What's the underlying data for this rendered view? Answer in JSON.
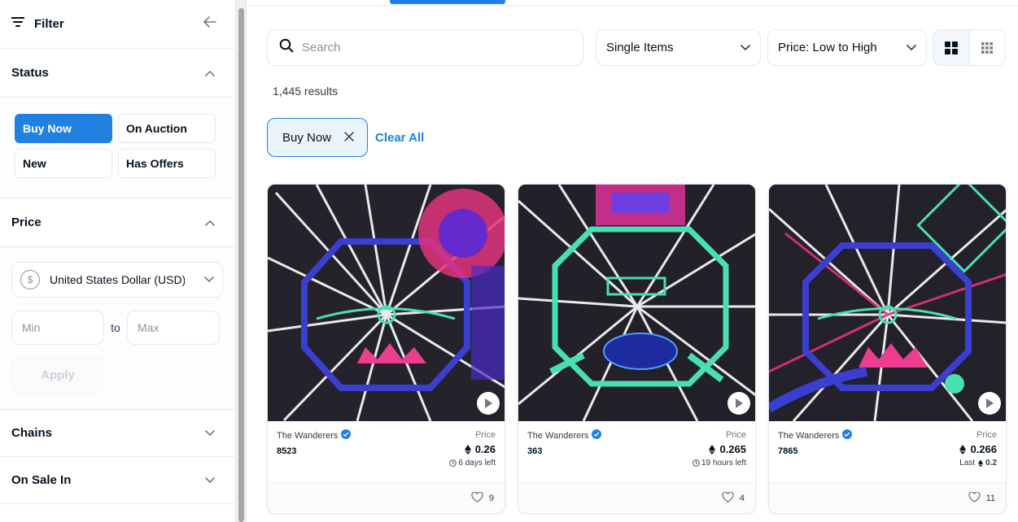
{
  "sidebar": {
    "filter_title": "Filter",
    "status": {
      "label": "Status",
      "options": [
        "Buy Now",
        "On Auction",
        "New",
        "Has Offers"
      ]
    },
    "price": {
      "label": "Price",
      "currency": "United States Dollar (USD)",
      "currency_symbol": "$",
      "min_placeholder": "Min",
      "to_label": "to",
      "max_placeholder": "Max",
      "apply_label": "Apply"
    },
    "chains_label": "Chains",
    "onsale_label": "On Sale In"
  },
  "toolbar": {
    "search_placeholder": "Search",
    "items_select": "Single Items",
    "sort_select": "Price: Low to High"
  },
  "results_text": "1,445 results",
  "active_filters": {
    "chip": "Buy Now",
    "clear_all": "Clear All"
  },
  "cards": [
    {
      "collection": "The Wanderers",
      "token": "8523",
      "price_label": "Price",
      "price": "0.26",
      "sub_text": "6 days left",
      "sub_type": "time",
      "likes": "9"
    },
    {
      "collection": "The Wanderers",
      "token": "363",
      "price_label": "Price",
      "price": "0.265",
      "sub_text": "19 hours left",
      "sub_type": "time",
      "likes": "4"
    },
    {
      "collection": "The Wanderers",
      "token": "7865",
      "price_label": "Price",
      "price": "0.266",
      "sub_text": "Last",
      "sub_value": "0.2",
      "sub_type": "last",
      "likes": "11"
    }
  ],
  "colors": {
    "accent": "#2081e2",
    "chip_bg": "#eaf4fb"
  }
}
